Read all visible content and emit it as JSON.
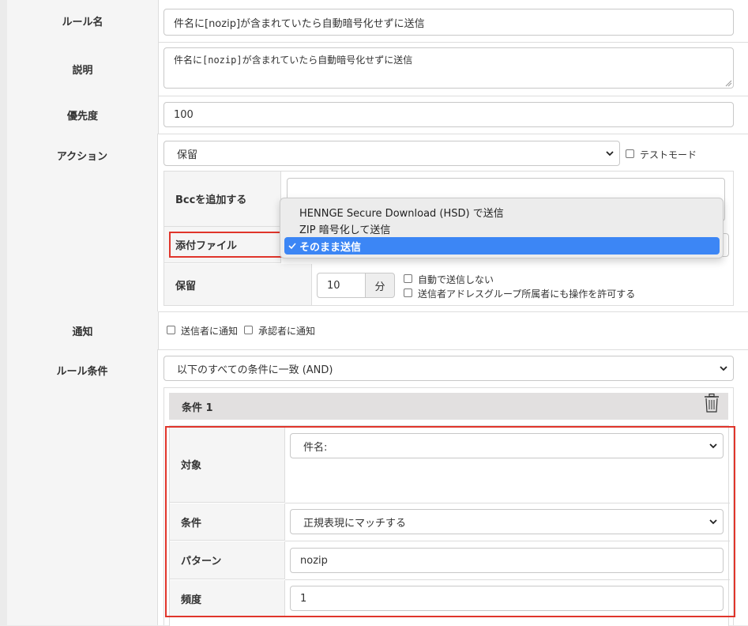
{
  "rule_name": {
    "label": "ルール名",
    "value": "件名に[nozip]が含まれていたら自動暗号化せずに送信"
  },
  "description": {
    "label": "説明",
    "value": "件名に[nozip]が含まれていたら自動暗号化せずに送信"
  },
  "priority": {
    "label": "優先度",
    "value": "100"
  },
  "action": {
    "label": "アクション",
    "selected": "保留",
    "test_mode_label": "テストモード",
    "test_mode_checked": false,
    "bcc_label": "Bccを追加する",
    "attachment_label": "添付ファイル",
    "attachment_options": [
      "HENNGE Secure Download (HSD) で送信",
      "ZIP 暗号化して送信",
      "そのまま送信"
    ],
    "attachment_selected_index": 2,
    "hold_label": "保留",
    "hold_minutes": "10",
    "hold_unit": "分",
    "auto_send_off_label": "自動で送信しない",
    "allow_group_label": "送信者アドレスグループ所属者にも操作を許可する"
  },
  "notify": {
    "label": "通知",
    "sender_label": "送信者に通知",
    "approver_label": "承認者に通知"
  },
  "conditions": {
    "label": "ルール条件",
    "match_mode": "以下のすべての条件に一致 (AND)",
    "condition_title": "条件 1",
    "target_label": "対象",
    "target_value": "件名:",
    "condition_label": "条件",
    "condition_value": "正規表現にマッチする",
    "pattern_label": "パターン",
    "pattern_value": "nozip",
    "frequency_label": "頻度",
    "frequency_value": "1"
  },
  "colors": {
    "highlight": "#e0352b",
    "dropdown_selected": "#3c86f5"
  }
}
